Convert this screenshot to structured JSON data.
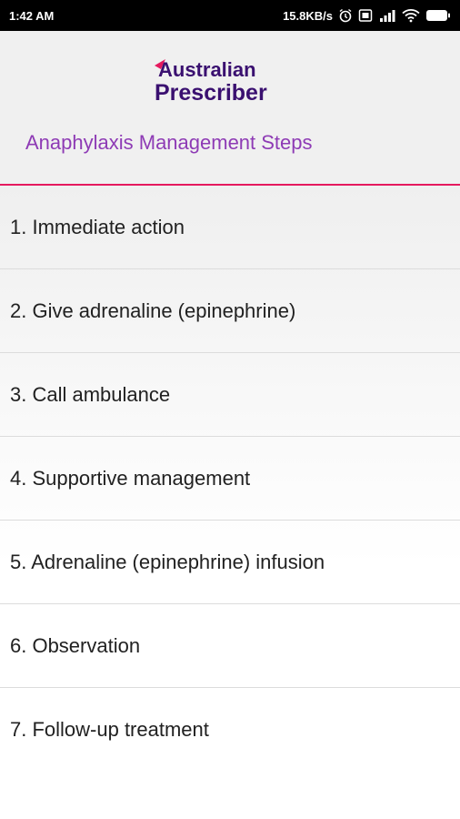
{
  "status_bar": {
    "time": "1:42 AM",
    "network_speed": "15.8KB/s",
    "icons": [
      "alarm-icon",
      "sim-icon",
      "signal-icon",
      "wifi-icon",
      "battery-icon"
    ]
  },
  "header": {
    "logo_line1": "Australian",
    "logo_line2": "Prescriber",
    "title": "Anaphylaxis Management Steps"
  },
  "steps": [
    {
      "label": "1. Immediate action"
    },
    {
      "label": "2. Give adrenaline (epinephrine)"
    },
    {
      "label": "3. Call ambulance"
    },
    {
      "label": "4. Supportive management"
    },
    {
      "label": "5. Adrenaline (epinephrine) infusion"
    },
    {
      "label": "6. Observation"
    },
    {
      "label": "7. Follow-up treatment"
    }
  ],
  "colors": {
    "accent_pink": "#e5195e",
    "title_purple": "#8e3bb5",
    "logo_purple": "#3a1070"
  }
}
